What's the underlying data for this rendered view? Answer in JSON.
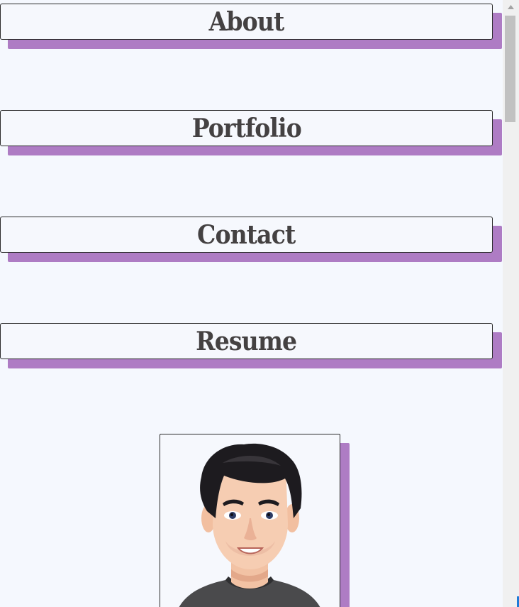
{
  "nav": {
    "items": [
      {
        "label": "About"
      },
      {
        "label": "Portfolio"
      },
      {
        "label": "Contact"
      },
      {
        "label": "Resume"
      }
    ]
  },
  "profile": {
    "avatar_icon": "cartoon-avatar-portrait"
  },
  "colors": {
    "background": "#f5f8fe",
    "shadow_accent": "#ae7cc4",
    "text": "#444142",
    "border": "#2b2b2b"
  }
}
